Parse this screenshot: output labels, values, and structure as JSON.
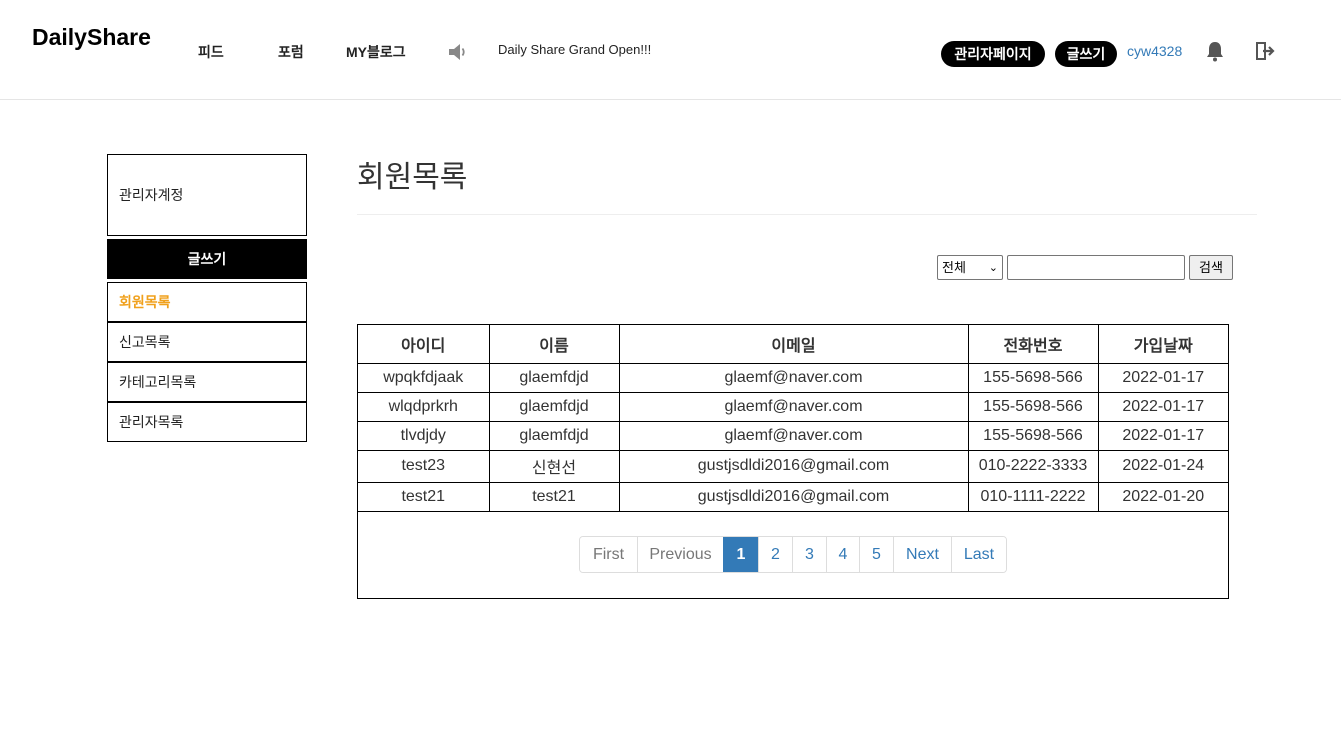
{
  "header": {
    "logo": "DailyShare",
    "nav": [
      "피드",
      "포럼",
      "MY블로그"
    ],
    "notice": "Daily Share Grand Open!!!",
    "admin_button": "관리자페이지",
    "write_button": "글쓰기",
    "username": "cyw4328"
  },
  "sidebar": {
    "account": "관리자계정",
    "write": "글쓰기",
    "menu": [
      "회원목록",
      "신고목록",
      "카테고리목록",
      "관리자목록"
    ]
  },
  "main": {
    "title": "회원목록",
    "search": {
      "selected": "전체",
      "value": "",
      "button": "검색"
    },
    "table": {
      "headers": [
        "아이디",
        "이름",
        "이메일",
        "전화번호",
        "가입날짜"
      ],
      "rows": [
        [
          "wpqkfdjaak",
          "glaemfdjd",
          "glaemf@naver.com",
          "155-5698-566",
          "2022-01-17"
        ],
        [
          "wlqdprkrh",
          "glaemfdjd",
          "glaemf@naver.com",
          "155-5698-566",
          "2022-01-17"
        ],
        [
          "tlvdjdy",
          "glaemfdjd",
          "glaemf@naver.com",
          "155-5698-566",
          "2022-01-17"
        ],
        [
          "test23",
          "신현선",
          "gustjsdldi2016@gmail.com",
          "010-2222-3333",
          "2022-01-24"
        ],
        [
          "test21",
          "test21",
          "gustjsdldi2016@gmail.com",
          "010-1111-2222",
          "2022-01-20"
        ]
      ]
    },
    "pagination": {
      "first": "First",
      "previous": "Previous",
      "pages": [
        "1",
        "2",
        "3",
        "4",
        "5"
      ],
      "current": "1",
      "next": "Next",
      "last": "Last"
    }
  }
}
